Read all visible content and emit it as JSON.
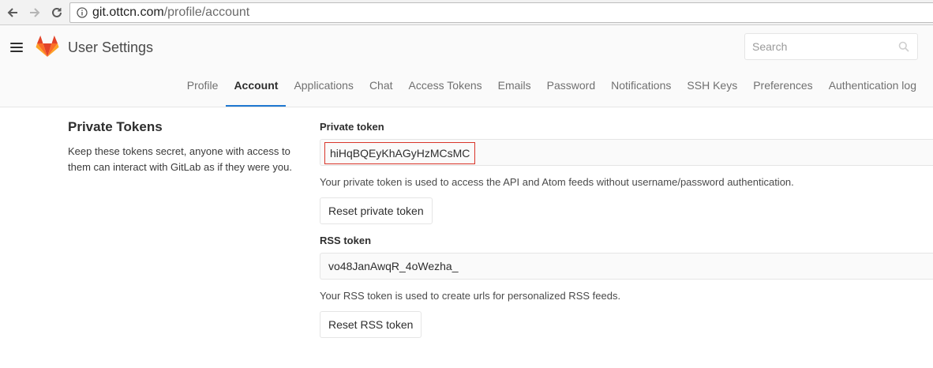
{
  "browser": {
    "url_host": "git.ottcn.com",
    "url_path": "/profile/account"
  },
  "header": {
    "title": "User Settings",
    "search_placeholder": "Search"
  },
  "tabs": [
    {
      "label": "Profile",
      "active": false
    },
    {
      "label": "Account",
      "active": true
    },
    {
      "label": "Applications",
      "active": false
    },
    {
      "label": "Chat",
      "active": false
    },
    {
      "label": "Access Tokens",
      "active": false
    },
    {
      "label": "Emails",
      "active": false
    },
    {
      "label": "Password",
      "active": false
    },
    {
      "label": "Notifications",
      "active": false
    },
    {
      "label": "SSH Keys",
      "active": false
    },
    {
      "label": "Preferences",
      "active": false
    },
    {
      "label": "Authentication log",
      "active": false
    }
  ],
  "section": {
    "title": "Private Tokens",
    "description": "Keep these tokens secret, anyone with access to them can interact with GitLab as if they were you."
  },
  "private_token": {
    "label": "Private token",
    "value": "hiHqBQEyKhAGyHzMCsMC",
    "help": "Your private token is used to access the API and Atom feeds without username/password authentication.",
    "reset_label": "Reset private token"
  },
  "rss_token": {
    "label": "RSS token",
    "value": "vo48JanAwqR_4oWezha_",
    "help": "Your RSS token is used to create urls for personalized RSS feeds.",
    "reset_label": "Reset RSS token"
  },
  "colors": {
    "accent": "#1f78d1",
    "highlight": "#d9352a",
    "logo_orange": "#e24329",
    "logo_light": "#fc6d26",
    "logo_yellow": "#fca326"
  }
}
